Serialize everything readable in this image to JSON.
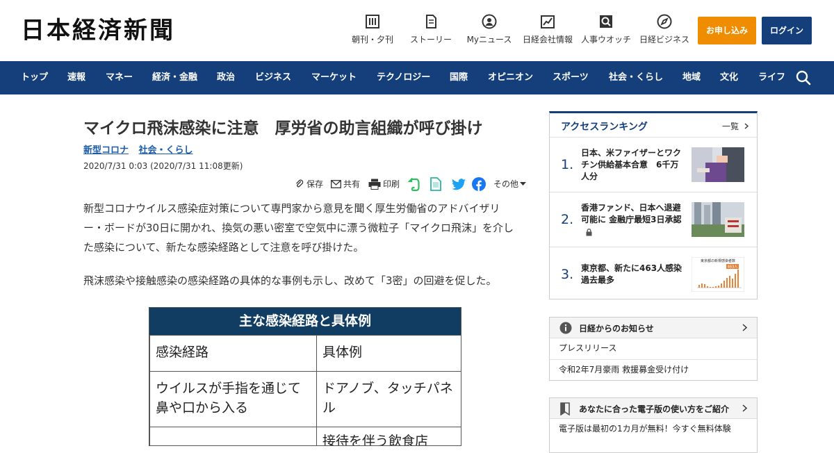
{
  "header": {
    "logo": "日本経済新聞",
    "icons": [
      {
        "label": "朝刊・夕刊",
        "icon": "newspaper-icon"
      },
      {
        "label": "ストーリー",
        "icon": "document-icon"
      },
      {
        "label": "Myニュース",
        "icon": "user-icon"
      },
      {
        "label": "日経会社情報",
        "icon": "chart-icon"
      },
      {
        "label": "人事ウオッチ",
        "icon": "search-person-icon"
      },
      {
        "label": "日経ビジネス",
        "icon": "compass-icon"
      }
    ],
    "subscribe_label": "お申し込み",
    "login_label": "ログイン"
  },
  "nav": {
    "items": [
      "トップ",
      "速報",
      "マネー",
      "経済・金融",
      "政治",
      "ビジネス",
      "マーケット",
      "テクノロジー",
      "国際",
      "オピニオン",
      "スポーツ",
      "社会・くらし",
      "地域",
      "文化",
      "ライフ"
    ]
  },
  "article": {
    "title": "マイクロ飛沫感染に注意　厚労省の助言組織が呼び掛け",
    "tags": [
      "新型コロナ",
      "社会・くらし"
    ],
    "date": "2020/7/31 0:03 (2020/7/31 11:08更新)",
    "share": {
      "save": "保存",
      "share": "共有",
      "print": "印刷",
      "other": "その他"
    },
    "paragraphs": [
      "新型コロナウイルス感染症対策について専門家から意見を聞く厚生労働省のアドバイザリー・ボードが30日に開かれ、換気の悪い密室で空気中に漂う微粒子「マイクロ飛沫」を介した感染について、新たな感染経路として注意を呼び掛けた。",
      "飛沫感染や接触感染の感染経路の具体的な事例も示し、改めて「3密」の回避を促した。"
    ],
    "figure": {
      "title": "主な感染経路と具体例",
      "headers": [
        "感染経路",
        "具体例"
      ],
      "rows": [
        [
          "ウイルスが手指を通じて鼻や口から入る",
          "ドアノブ、タッチパネル"
        ],
        [
          "",
          "接待を伴う飲食店"
        ]
      ]
    }
  },
  "ranking": {
    "title": "アクセスランキング",
    "more": "一覧",
    "items": [
      {
        "num": "1.",
        "text": "日本、米ファイザーとワクチン供給基本合意　6千万人分"
      },
      {
        "num": "2.",
        "text": "香港ファンド、日本へ退避可能に 金融庁最短3日承認"
      },
      {
        "num": "3.",
        "text": "東京都、新たに463人感染　過去最多"
      }
    ],
    "thumb3_caption": "東京都の新規感染者数",
    "thumb3_badge": "463人"
  },
  "notices": {
    "title": "日経からのお知らせ",
    "rows": [
      "プレスリリース",
      "令和2年7月豪雨 救援募金受け付け"
    ]
  },
  "guide": {
    "title": "あなたに合った電子版の使い方をご紹介",
    "rows": [
      "電子版は最初の1カ月が無料！今すぐ無料体験"
    ]
  },
  "colors": {
    "brand_navy": "#153f7a",
    "subscribe_orange": "#f08c00",
    "link_blue": "#1a5aa8",
    "figure_header": "#123d63"
  }
}
